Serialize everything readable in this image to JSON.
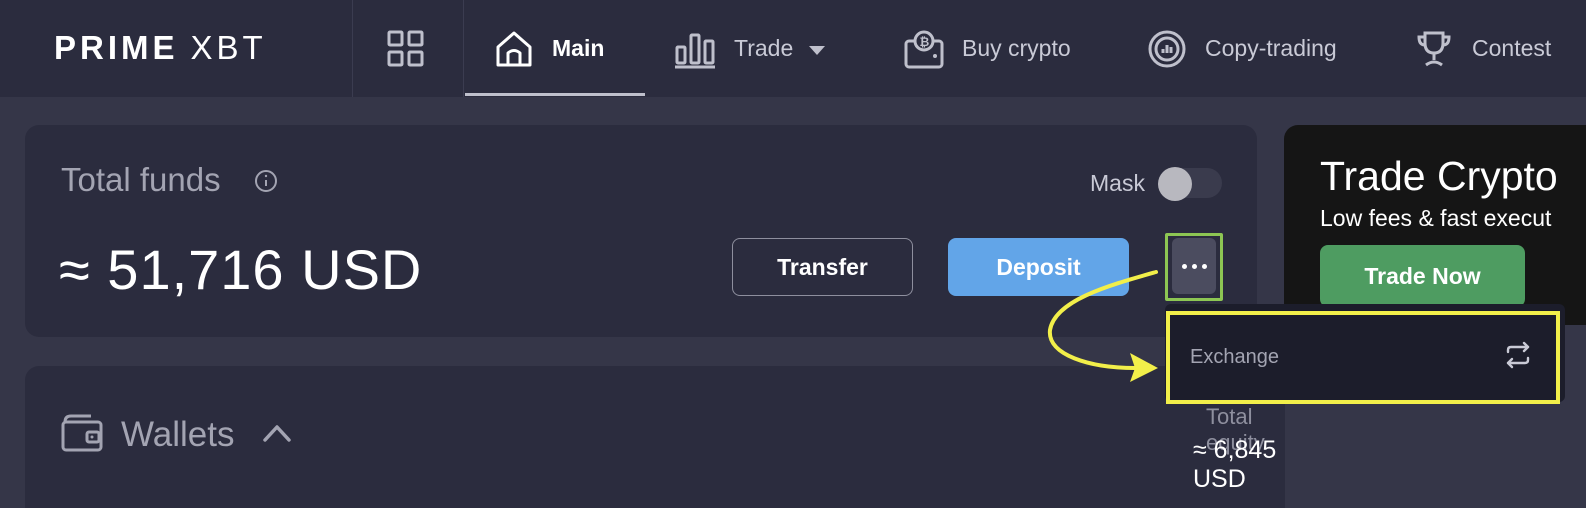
{
  "nav": {
    "logo_prime": "PRIME",
    "logo_xbt": "XBT",
    "items": [
      {
        "label": "Main",
        "icon": "home-icon"
      },
      {
        "label": "Trade",
        "icon": "bar-chart-icon"
      },
      {
        "label": "Buy crypto",
        "icon": "bitcoin-wallet-icon"
      },
      {
        "label": "Copy-trading",
        "icon": "copy-trading-icon"
      },
      {
        "label": "Contest",
        "icon": "trophy-icon"
      }
    ]
  },
  "funds": {
    "title": "Total funds",
    "mask_label": "Mask",
    "amount": "≈ 51,716 USD",
    "transfer_label": "Transfer",
    "deposit_label": "Deposit"
  },
  "dropdown": {
    "items": [
      {
        "label": "Exchange",
        "icon": "exchange-arrows-icon"
      }
    ]
  },
  "wallets": {
    "title": "Wallets",
    "equity_label": "Total equity",
    "equity_value": "≈ 6,845 USD"
  },
  "promo": {
    "title": "Trade Crypto",
    "subtitle": "Low fees & fast execut",
    "button_label": "Trade Now"
  },
  "colors": {
    "nav_bg": "#2b2c3e",
    "page_bg": "#353648",
    "deposit_blue": "#62a5e8",
    "trade_now_green": "#4e9c61",
    "highlight_green": "#8dc653",
    "highlight_yellow": "#f2ef4a"
  }
}
